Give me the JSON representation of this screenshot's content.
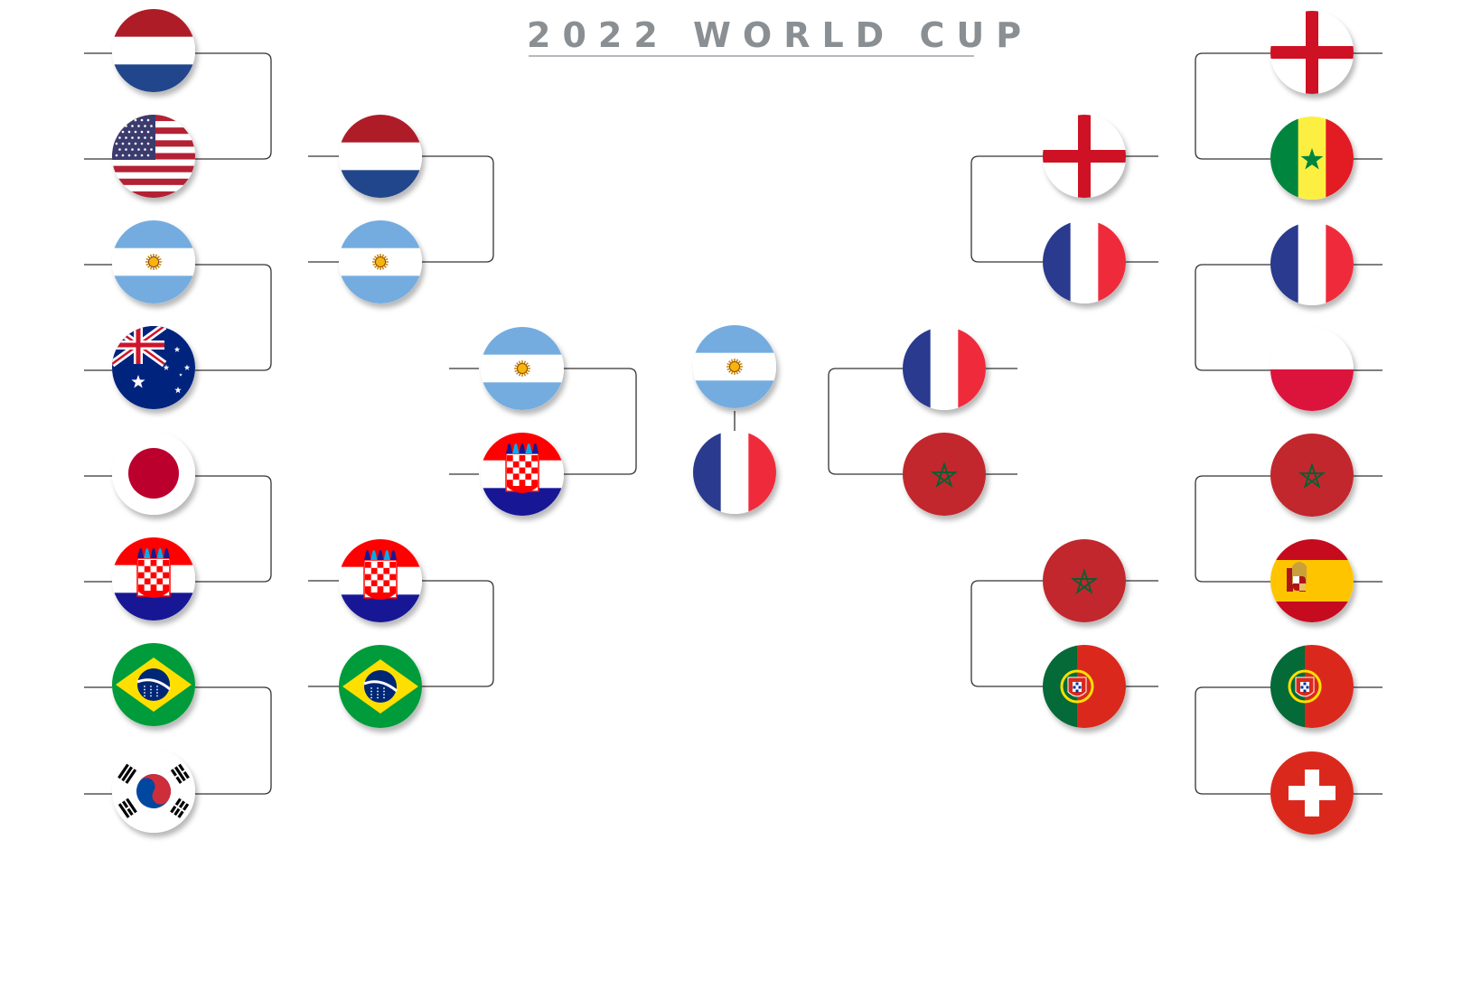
{
  "title": "2022 WORLD CUP",
  "colors": {
    "title": "#8a8f93",
    "line": "#333333",
    "red": "#e02b2c",
    "dutch_red": "#ae1c28",
    "dutch_blue": "#21468b",
    "light_blue": "#74acdf",
    "sun": "#c48a1a",
    "navy": "#00247d",
    "white": "#ffffff",
    "green": "#009c3b",
    "yellow": "#ffdf00",
    "french_blue": "#2a3a8e",
    "french_red": "#ef2b3b",
    "moroccan_red": "#c1272d",
    "moroccan_green": "#006233",
    "portugal_green": "#046a38",
    "portugal_red": "#da291c",
    "senegal_green": "#00853f",
    "senegal_yellow": "#fdef42",
    "senegal_red": "#e31b23",
    "spain_red": "#c60b1e",
    "spain_yellow": "#ffc400",
    "swiss_red": "#da291c",
    "korea_red": "#cd2e3a",
    "korea_blue": "#0047a0",
    "japan_red": "#bc002d",
    "croatia_red": "#ff0000",
    "croatia_blue": "#171796"
  },
  "bracket": {
    "left_round_of_16": [
      {
        "team": "netherlands",
        "flag_icon": "netherlands-flag-icon"
      },
      {
        "team": "usa",
        "flag_icon": "usa-flag-icon"
      },
      {
        "team": "argentina",
        "flag_icon": "argentina-flag-icon"
      },
      {
        "team": "australia",
        "flag_icon": "australia-flag-icon"
      },
      {
        "team": "japan",
        "flag_icon": "japan-flag-icon"
      },
      {
        "team": "croatia",
        "flag_icon": "croatia-flag-icon"
      },
      {
        "team": "brazil",
        "flag_icon": "brazil-flag-icon"
      },
      {
        "team": "south-korea",
        "flag_icon": "south-korea-flag-icon"
      }
    ],
    "left_quarterfinals": [
      {
        "team": "netherlands",
        "flag_icon": "netherlands-flag-icon"
      },
      {
        "team": "argentina",
        "flag_icon": "argentina-flag-icon"
      },
      {
        "team": "croatia",
        "flag_icon": "croatia-flag-icon"
      },
      {
        "team": "brazil",
        "flag_icon": "brazil-flag-icon"
      }
    ],
    "left_semifinals": [
      {
        "team": "argentina",
        "flag_icon": "argentina-flag-icon"
      },
      {
        "team": "croatia",
        "flag_icon": "croatia-flag-icon"
      }
    ],
    "final": [
      {
        "team": "argentina",
        "flag_icon": "argentina-flag-icon"
      },
      {
        "team": "france",
        "flag_icon": "france-flag-icon"
      }
    ],
    "right_semifinals": [
      {
        "team": "france",
        "flag_icon": "france-flag-icon"
      },
      {
        "team": "morocco",
        "flag_icon": "morocco-flag-icon"
      }
    ],
    "right_quarterfinals": [
      {
        "team": "england",
        "flag_icon": "england-flag-icon"
      },
      {
        "team": "france",
        "flag_icon": "france-flag-icon"
      },
      {
        "team": "morocco",
        "flag_icon": "morocco-flag-icon"
      },
      {
        "team": "portugal",
        "flag_icon": "portugal-flag-icon"
      }
    ],
    "right_round_of_16": [
      {
        "team": "england",
        "flag_icon": "england-flag-icon"
      },
      {
        "team": "senegal",
        "flag_icon": "senegal-flag-icon"
      },
      {
        "team": "france",
        "flag_icon": "france-flag-icon"
      },
      {
        "team": "poland",
        "flag_icon": "poland-flag-icon"
      },
      {
        "team": "morocco",
        "flag_icon": "morocco-flag-icon"
      },
      {
        "team": "spain",
        "flag_icon": "spain-flag-icon"
      },
      {
        "team": "portugal",
        "flag_icon": "portugal-flag-icon"
      },
      {
        "team": "switzerland",
        "flag_icon": "switzerland-flag-icon"
      }
    ]
  }
}
